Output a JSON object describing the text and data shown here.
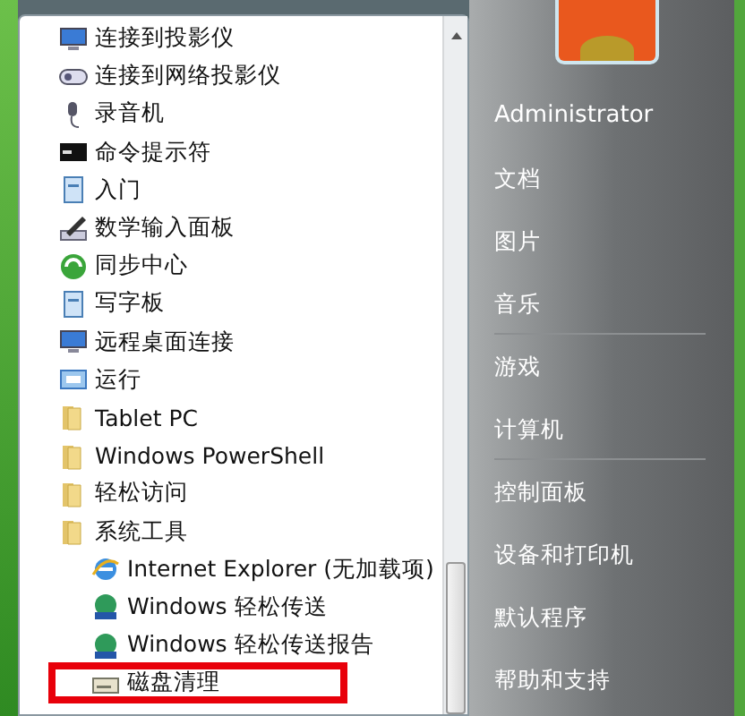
{
  "programs": [
    {
      "label": "连接到投影仪",
      "kind": "monitor"
    },
    {
      "label": "连接到网络投影仪",
      "kind": "projector"
    },
    {
      "label": "录音机",
      "kind": "microphone"
    },
    {
      "label": "命令提示符",
      "kind": "console"
    },
    {
      "label": "入门",
      "kind": "document"
    },
    {
      "label": "数学输入面板",
      "kind": "pen"
    },
    {
      "label": "同步中心",
      "kind": "sync"
    },
    {
      "label": "写字板",
      "kind": "wordpad"
    },
    {
      "label": "远程桌面连接",
      "kind": "remote"
    },
    {
      "label": "运行",
      "kind": "run"
    },
    {
      "label": "Tablet PC",
      "kind": "folder"
    },
    {
      "label": "Windows PowerShell",
      "kind": "folder"
    },
    {
      "label": "轻松访问",
      "kind": "folder"
    },
    {
      "label": "系统工具",
      "kind": "folder",
      "children": [
        {
          "label": "Internet Explorer (无加载项)",
          "kind": "ie",
          "highlighted": false
        },
        {
          "label": "Windows 轻松传送",
          "kind": "transfer",
          "highlighted": false
        },
        {
          "label": "Windows 轻松传送报告",
          "kind": "transfer",
          "highlighted": false
        },
        {
          "label": "磁盘清理",
          "kind": "disk",
          "highlighted": true
        }
      ]
    }
  ],
  "user": {
    "name": "Administrator"
  },
  "places": [
    {
      "label": "文档",
      "separator_after": false
    },
    {
      "label": "图片",
      "separator_after": false
    },
    {
      "label": "音乐",
      "separator_after": true
    },
    {
      "label": "游戏",
      "separator_after": false
    },
    {
      "label": "计算机",
      "separator_after": true
    },
    {
      "label": "控制面板",
      "separator_after": false
    },
    {
      "label": "设备和打印机",
      "separator_after": false
    },
    {
      "label": "默认程序",
      "separator_after": false
    },
    {
      "label": "帮助和支持",
      "separator_after": false
    }
  ]
}
